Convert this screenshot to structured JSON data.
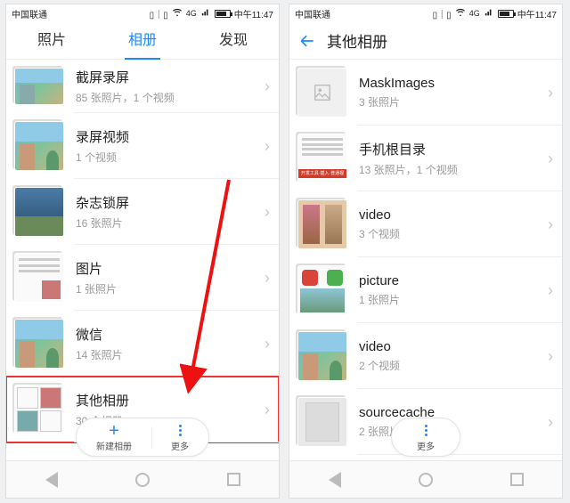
{
  "left": {
    "status": {
      "carrier": "中国联通",
      "net": "4G",
      "time": "中午11:47"
    },
    "tabs": {
      "t1": "照片",
      "t2": "相册",
      "t3": "发现"
    },
    "rows": [
      {
        "title": "截屏录屏",
        "sub": "85 张照片，1 个视频"
      },
      {
        "title": "录屏视频",
        "sub": "1 个视频"
      },
      {
        "title": "杂志锁屏",
        "sub": "16 张照片"
      },
      {
        "title": "图片",
        "sub": "1 张照片"
      },
      {
        "title": "微信",
        "sub": "14 张照片"
      },
      {
        "title": "其他相册",
        "sub": "30 个相册"
      }
    ],
    "pill": {
      "new": "新建相册",
      "more": "更多"
    }
  },
  "right": {
    "status": {
      "carrier": "中国联通",
      "net": "4G",
      "time": "中午11:47"
    },
    "header": {
      "title": "其他相册"
    },
    "rows": [
      {
        "title": "MaskImages",
        "sub": "3 张照片"
      },
      {
        "title": "手机根目录",
        "sub": "13 张照片，1 个视频"
      },
      {
        "title": "video",
        "sub": "3 个视频"
      },
      {
        "title": "picture",
        "sub": "1 张照片"
      },
      {
        "title": "video",
        "sub": "2 个视频"
      },
      {
        "title": "sourcecache",
        "sub": "2 张照片"
      }
    ],
    "pill": {
      "more": "更多"
    }
  }
}
